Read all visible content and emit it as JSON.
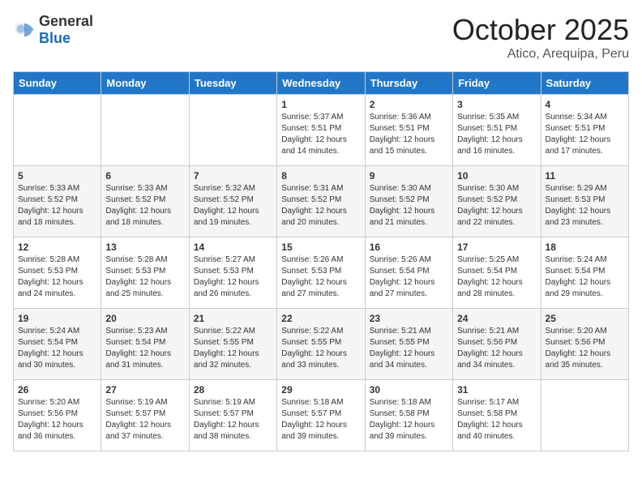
{
  "header": {
    "logo_general": "General",
    "logo_blue": "Blue",
    "month_title": "October 2025",
    "location": "Atico, Arequipa, Peru"
  },
  "weekdays": [
    "Sunday",
    "Monday",
    "Tuesday",
    "Wednesday",
    "Thursday",
    "Friday",
    "Saturday"
  ],
  "weeks": [
    [
      {
        "day": "",
        "info": ""
      },
      {
        "day": "",
        "info": ""
      },
      {
        "day": "",
        "info": ""
      },
      {
        "day": "1",
        "info": "Sunrise: 5:37 AM\nSunset: 5:51 PM\nDaylight: 12 hours\nand 14 minutes."
      },
      {
        "day": "2",
        "info": "Sunrise: 5:36 AM\nSunset: 5:51 PM\nDaylight: 12 hours\nand 15 minutes."
      },
      {
        "day": "3",
        "info": "Sunrise: 5:35 AM\nSunset: 5:51 PM\nDaylight: 12 hours\nand 16 minutes."
      },
      {
        "day": "4",
        "info": "Sunrise: 5:34 AM\nSunset: 5:51 PM\nDaylight: 12 hours\nand 17 minutes."
      }
    ],
    [
      {
        "day": "5",
        "info": "Sunrise: 5:33 AM\nSunset: 5:52 PM\nDaylight: 12 hours\nand 18 minutes."
      },
      {
        "day": "6",
        "info": "Sunrise: 5:33 AM\nSunset: 5:52 PM\nDaylight: 12 hours\nand 18 minutes."
      },
      {
        "day": "7",
        "info": "Sunrise: 5:32 AM\nSunset: 5:52 PM\nDaylight: 12 hours\nand 19 minutes."
      },
      {
        "day": "8",
        "info": "Sunrise: 5:31 AM\nSunset: 5:52 PM\nDaylight: 12 hours\nand 20 minutes."
      },
      {
        "day": "9",
        "info": "Sunrise: 5:30 AM\nSunset: 5:52 PM\nDaylight: 12 hours\nand 21 minutes."
      },
      {
        "day": "10",
        "info": "Sunrise: 5:30 AM\nSunset: 5:52 PM\nDaylight: 12 hours\nand 22 minutes."
      },
      {
        "day": "11",
        "info": "Sunrise: 5:29 AM\nSunset: 5:53 PM\nDaylight: 12 hours\nand 23 minutes."
      }
    ],
    [
      {
        "day": "12",
        "info": "Sunrise: 5:28 AM\nSunset: 5:53 PM\nDaylight: 12 hours\nand 24 minutes."
      },
      {
        "day": "13",
        "info": "Sunrise: 5:28 AM\nSunset: 5:53 PM\nDaylight: 12 hours\nand 25 minutes."
      },
      {
        "day": "14",
        "info": "Sunrise: 5:27 AM\nSunset: 5:53 PM\nDaylight: 12 hours\nand 26 minutes."
      },
      {
        "day": "15",
        "info": "Sunrise: 5:26 AM\nSunset: 5:53 PM\nDaylight: 12 hours\nand 27 minutes."
      },
      {
        "day": "16",
        "info": "Sunrise: 5:26 AM\nSunset: 5:54 PM\nDaylight: 12 hours\nand 27 minutes."
      },
      {
        "day": "17",
        "info": "Sunrise: 5:25 AM\nSunset: 5:54 PM\nDaylight: 12 hours\nand 28 minutes."
      },
      {
        "day": "18",
        "info": "Sunrise: 5:24 AM\nSunset: 5:54 PM\nDaylight: 12 hours\nand 29 minutes."
      }
    ],
    [
      {
        "day": "19",
        "info": "Sunrise: 5:24 AM\nSunset: 5:54 PM\nDaylight: 12 hours\nand 30 minutes."
      },
      {
        "day": "20",
        "info": "Sunrise: 5:23 AM\nSunset: 5:54 PM\nDaylight: 12 hours\nand 31 minutes."
      },
      {
        "day": "21",
        "info": "Sunrise: 5:22 AM\nSunset: 5:55 PM\nDaylight: 12 hours\nand 32 minutes."
      },
      {
        "day": "22",
        "info": "Sunrise: 5:22 AM\nSunset: 5:55 PM\nDaylight: 12 hours\nand 33 minutes."
      },
      {
        "day": "23",
        "info": "Sunrise: 5:21 AM\nSunset: 5:55 PM\nDaylight: 12 hours\nand 34 minutes."
      },
      {
        "day": "24",
        "info": "Sunrise: 5:21 AM\nSunset: 5:56 PM\nDaylight: 12 hours\nand 34 minutes."
      },
      {
        "day": "25",
        "info": "Sunrise: 5:20 AM\nSunset: 5:56 PM\nDaylight: 12 hours\nand 35 minutes."
      }
    ],
    [
      {
        "day": "26",
        "info": "Sunrise: 5:20 AM\nSunset: 5:56 PM\nDaylight: 12 hours\nand 36 minutes."
      },
      {
        "day": "27",
        "info": "Sunrise: 5:19 AM\nSunset: 5:57 PM\nDaylight: 12 hours\nand 37 minutes."
      },
      {
        "day": "28",
        "info": "Sunrise: 5:19 AM\nSunset: 5:57 PM\nDaylight: 12 hours\nand 38 minutes."
      },
      {
        "day": "29",
        "info": "Sunrise: 5:18 AM\nSunset: 5:57 PM\nDaylight: 12 hours\nand 39 minutes."
      },
      {
        "day": "30",
        "info": "Sunrise: 5:18 AM\nSunset: 5:58 PM\nDaylight: 12 hours\nand 39 minutes."
      },
      {
        "day": "31",
        "info": "Sunrise: 5:17 AM\nSunset: 5:58 PM\nDaylight: 12 hours\nand 40 minutes."
      },
      {
        "day": "",
        "info": ""
      }
    ]
  ]
}
